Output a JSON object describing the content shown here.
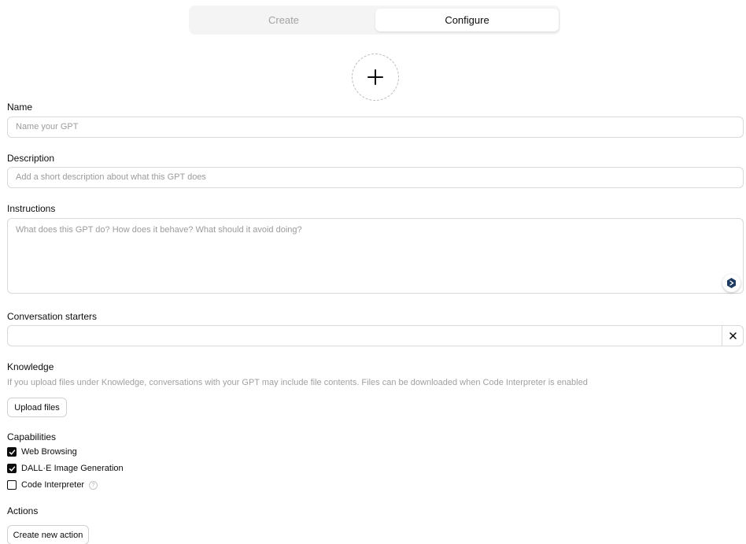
{
  "tabs": [
    {
      "label": "Create",
      "active": false
    },
    {
      "label": "Configure",
      "active": true
    }
  ],
  "avatar": {
    "icon": "plus-icon"
  },
  "name": {
    "label": "Name",
    "placeholder": "Name your GPT",
    "value": ""
  },
  "description": {
    "label": "Description",
    "placeholder": "Add a short description about what this GPT does",
    "value": ""
  },
  "instructions": {
    "label": "Instructions",
    "placeholder": "What does this GPT do? How does it behave? What should it avoid doing?",
    "value": ""
  },
  "conversation_starters": {
    "label": "Conversation starters",
    "value": "",
    "remove_icon": "close-icon"
  },
  "knowledge": {
    "label": "Knowledge",
    "helper": "If you upload files under Knowledge, conversations with your GPT may include file contents. Files can be downloaded when Code Interpreter is enabled",
    "upload_label": "Upload files"
  },
  "capabilities": {
    "label": "Capabilities",
    "items": [
      {
        "label": "Web Browsing",
        "checked": true
      },
      {
        "label": "DALL·E Image Generation",
        "checked": true
      },
      {
        "label": "Code Interpreter",
        "checked": false,
        "info": "?"
      }
    ]
  },
  "actions": {
    "label": "Actions",
    "create_label": "Create new action"
  },
  "colors": {
    "text": "#0d0d0d",
    "placeholder": "#9b9b9b",
    "border": "#d9d9d9",
    "tab_bg": "#f4f4f4"
  }
}
